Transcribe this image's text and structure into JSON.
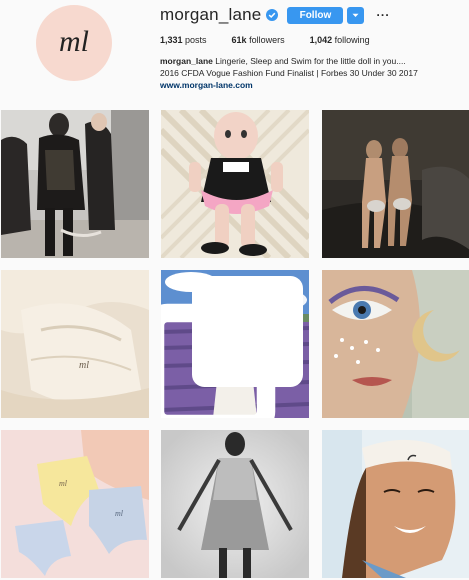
{
  "profile": {
    "username": "morgan_lane",
    "avatar_text": "ml",
    "follow_label": "Follow",
    "more_label": "···",
    "stats": [
      {
        "count": "1,331",
        "label": " posts"
      },
      {
        "count": "61k",
        "label": " followers"
      },
      {
        "count": "1,042",
        "label": " following"
      }
    ],
    "bio": {
      "name": "morgan_lane",
      "text": " Lingerie, Sleep and Swim for the little doll in you....",
      "line2": "2016 CFDA Vogue Fashion Fund Finalist | Forbes 30 Under 30 2017",
      "link": "www.morgan-lane.com"
    }
  },
  "colors": {
    "accent": "#3897f0",
    "link": "#003569",
    "avatar_bg": "#f7d9cf",
    "background": "#fafafa"
  },
  "icons": {
    "verified": "verified-badge-icon",
    "dropdown": "chevron-down-icon",
    "more": "ellipsis-icon",
    "multi_post": "carousel-icon"
  },
  "grid": {
    "posts": [
      {
        "name": "post-street-style"
      },
      {
        "name": "post-doll-plush"
      },
      {
        "name": "post-bathers"
      },
      {
        "name": "post-silk-lingerie"
      },
      {
        "name": "post-lavender-field"
      },
      {
        "name": "post-glitter-makeup"
      },
      {
        "name": "post-pastel-panties"
      },
      {
        "name": "post-mod-dress"
      },
      {
        "name": "post-sleep-mask-smile"
      }
    ]
  }
}
